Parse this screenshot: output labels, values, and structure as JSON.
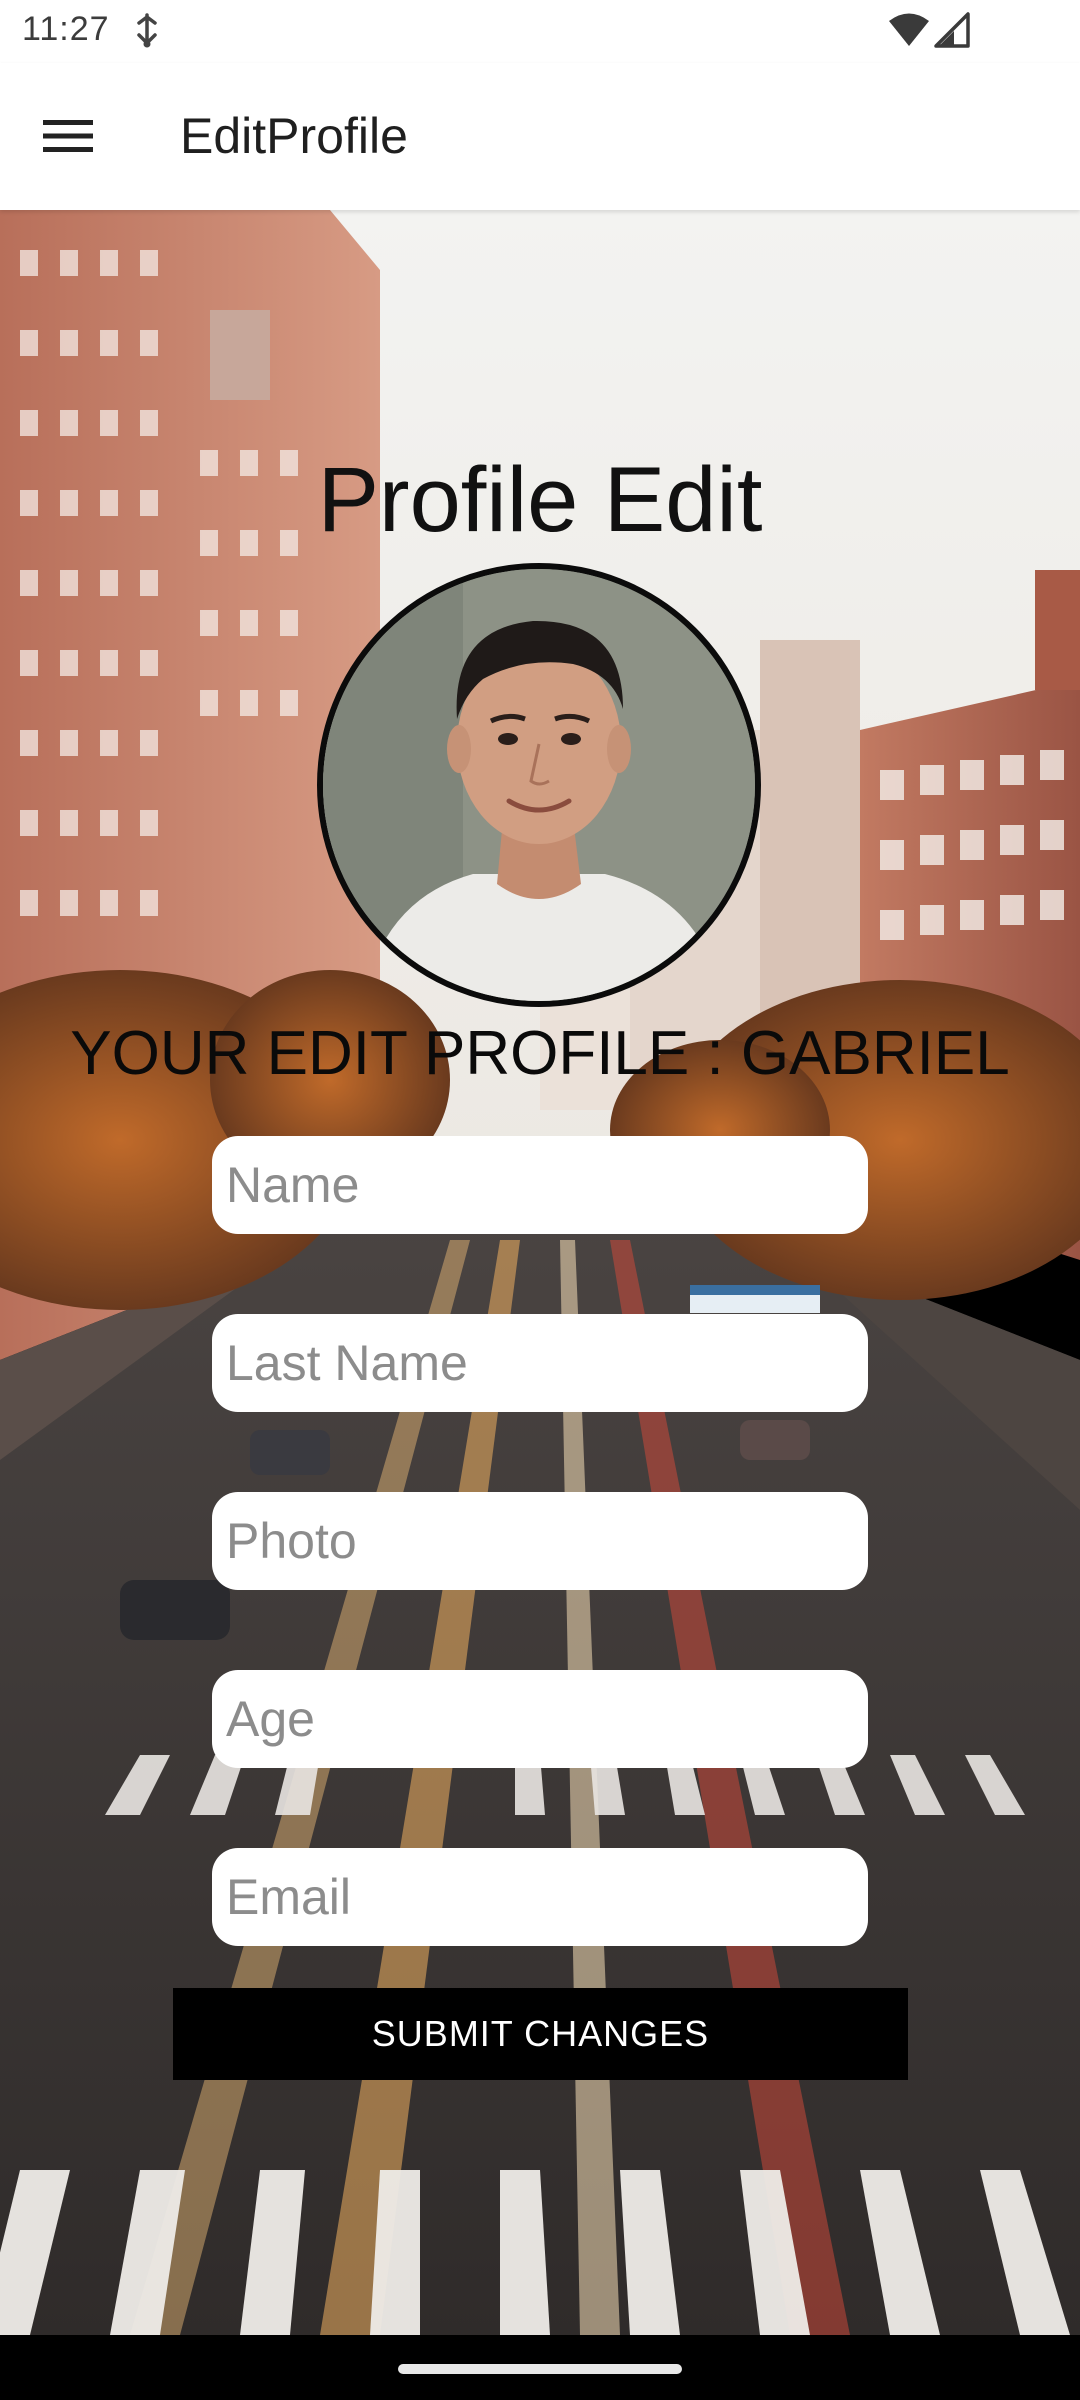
{
  "status_bar": {
    "time": "11:27",
    "icons": [
      "usb-icon",
      "wifi-icon",
      "signal-icon"
    ]
  },
  "app_bar": {
    "title": "EditProfile",
    "menu_icon": "hamburger-menu-icon"
  },
  "main": {
    "title": "Profile Edit",
    "heading": "YOUR EDIT PROFILE : GABRIEL",
    "fields": {
      "name": {
        "placeholder": "Name",
        "value": ""
      },
      "last_name": {
        "placeholder": "Last Name",
        "value": ""
      },
      "photo": {
        "placeholder": "Photo",
        "value": ""
      },
      "age": {
        "placeholder": "Age",
        "value": ""
      },
      "email": {
        "placeholder": "Email",
        "value": ""
      }
    },
    "submit_label": "SUBMIT CHANGES"
  },
  "colors": {
    "app_bar_bg": "#ffffff",
    "button_bg": "#000000",
    "button_text": "#ffffff",
    "field_bg": "#ffffff",
    "placeholder": "#8c8c8c"
  }
}
